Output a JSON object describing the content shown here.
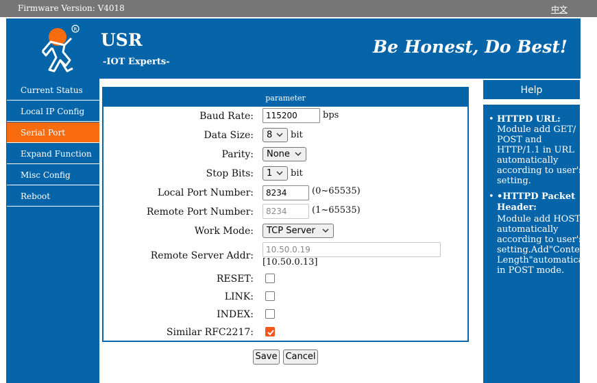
{
  "topbar": {
    "firmware": "Firmware Version: V4018",
    "language": "中文"
  },
  "header": {
    "brand": "USR",
    "subtitle": "-IOT Experts-",
    "slogan": "Be Honest, Do Best!"
  },
  "sidebar": {
    "items": [
      {
        "label": "Current Status",
        "active": false
      },
      {
        "label": "Local IP Config",
        "active": false
      },
      {
        "label": "Serial Port",
        "active": true
      },
      {
        "label": "Expand Function",
        "active": false
      },
      {
        "label": "Misc Config",
        "active": false
      },
      {
        "label": "Reboot",
        "active": false
      }
    ]
  },
  "panel": {
    "title": "parameter",
    "baud_rate": {
      "label": "Baud Rate:",
      "value": "115200",
      "unit": "bps"
    },
    "data_size": {
      "label": "Data Size:",
      "value": "8",
      "unit": "bit"
    },
    "parity": {
      "label": "Parity:",
      "value": "None"
    },
    "stop_bits": {
      "label": "Stop Bits:",
      "value": "1",
      "unit": "bit"
    },
    "local_port": {
      "label": "Local Port Number:",
      "value": "8234",
      "range": "(0~65535)"
    },
    "remote_port": {
      "label": "Remote Port Number:",
      "placeholder": "8234",
      "range": "(1~65535)"
    },
    "work_mode": {
      "label": "Work Mode:",
      "value": "TCP Server"
    },
    "remote_server": {
      "label": "Remote Server Addr:",
      "placeholder": "10.50.0.19",
      "current": "[10.50.0.13]"
    },
    "reset": {
      "label": "RESET:",
      "checked": false
    },
    "link": {
      "label": "LINK:",
      "checked": false
    },
    "index": {
      "label": "INDEX:",
      "checked": false
    },
    "rfc2217": {
      "label": "Similar RFC2217:",
      "checked": true
    }
  },
  "buttons": {
    "save": "Save",
    "cancel": "Cancel"
  },
  "help": {
    "title": "Help",
    "items": [
      {
        "bullet": "•",
        "title": "HTTPD URL:",
        "lines": [
          "Module add GET/",
          "POST and",
          "HTTP/1.1 in URL",
          "automatically",
          "according to user's",
          "setting."
        ]
      },
      {
        "bullet": "•",
        "title": "•HTTPD Packet",
        "lines": [
          "Header:",
          "Module add HOST",
          "automatically",
          "according to user's",
          "setting.Add\"Content",
          "Length\"automatical",
          "in POST mode."
        ]
      }
    ]
  },
  "colors": {
    "primary": "#0565a8",
    "accent": "#f96b0f",
    "topbar": "#767676"
  }
}
